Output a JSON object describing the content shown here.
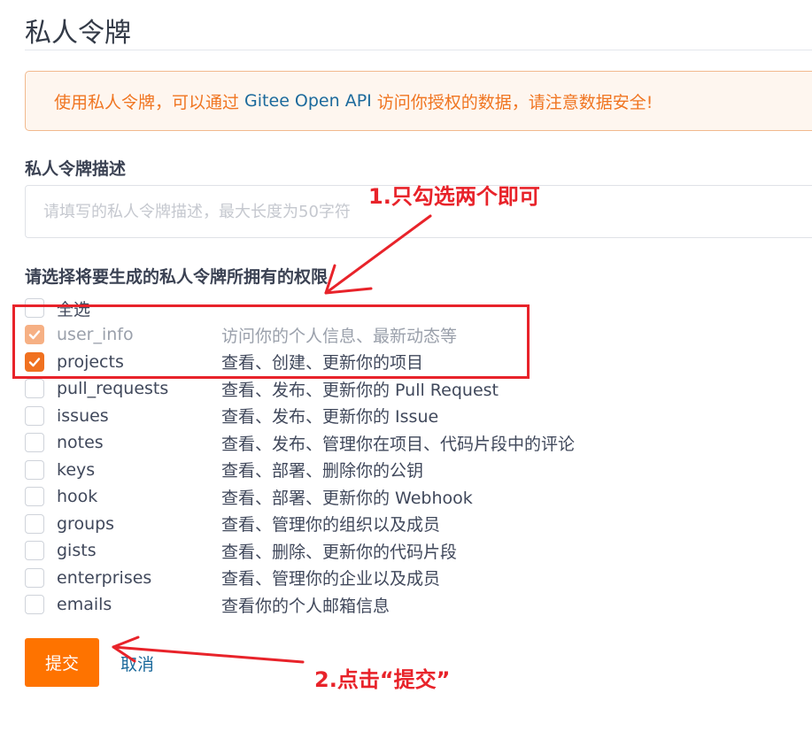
{
  "page": {
    "title": "私人令牌"
  },
  "alert": {
    "prefix": "使用私人令牌，可以通过 ",
    "link_text": "Gitee Open API",
    "suffix": " 访问你授权的数据，请注意数据安全!"
  },
  "description": {
    "label": "私人令牌描述",
    "placeholder": "请填写的私人令牌描述，最大长度为50字符",
    "value": ""
  },
  "permissions": {
    "label": "请选择将要生成的私人令牌所拥有的权限",
    "select_all_label": "全选",
    "items": [
      {
        "name": "user_info",
        "desc": "访问你的个人信息、最新动态等",
        "checked": true,
        "disabled": true
      },
      {
        "name": "projects",
        "desc": "查看、创建、更新你的项目",
        "checked": true,
        "disabled": false
      },
      {
        "name": "pull_requests",
        "desc": "查看、发布、更新你的 Pull Request",
        "checked": false,
        "disabled": false
      },
      {
        "name": "issues",
        "desc": "查看、发布、更新你的 Issue",
        "checked": false,
        "disabled": false
      },
      {
        "name": "notes",
        "desc": "查看、发布、管理你在项目、代码片段中的评论",
        "checked": false,
        "disabled": false
      },
      {
        "name": "keys",
        "desc": "查看、部署、删除你的公钥",
        "checked": false,
        "disabled": false
      },
      {
        "name": "hook",
        "desc": "查看、部署、更新你的 Webhook",
        "checked": false,
        "disabled": false
      },
      {
        "name": "groups",
        "desc": "查看、管理你的组织以及成员",
        "checked": false,
        "disabled": false
      },
      {
        "name": "gists",
        "desc": "查看、删除、更新你的代码片段",
        "checked": false,
        "disabled": false
      },
      {
        "name": "enterprises",
        "desc": "查看、管理你的企业以及成员",
        "checked": false,
        "disabled": false
      },
      {
        "name": "emails",
        "desc": "查看你的个人邮箱信息",
        "checked": false,
        "disabled": false
      }
    ]
  },
  "actions": {
    "submit_label": "提交",
    "cancel_label": "取消"
  },
  "annotations": {
    "note1": "1.只勾选两个即可",
    "note2": "2.点击“提交”",
    "color": "#e8232a"
  },
  "colors": {
    "accent": "#fe7300",
    "checkbox_checked": "#f07120",
    "link": "#1c6a9c",
    "alert_text": "#f07521",
    "alert_bg": "#fef6ef"
  }
}
